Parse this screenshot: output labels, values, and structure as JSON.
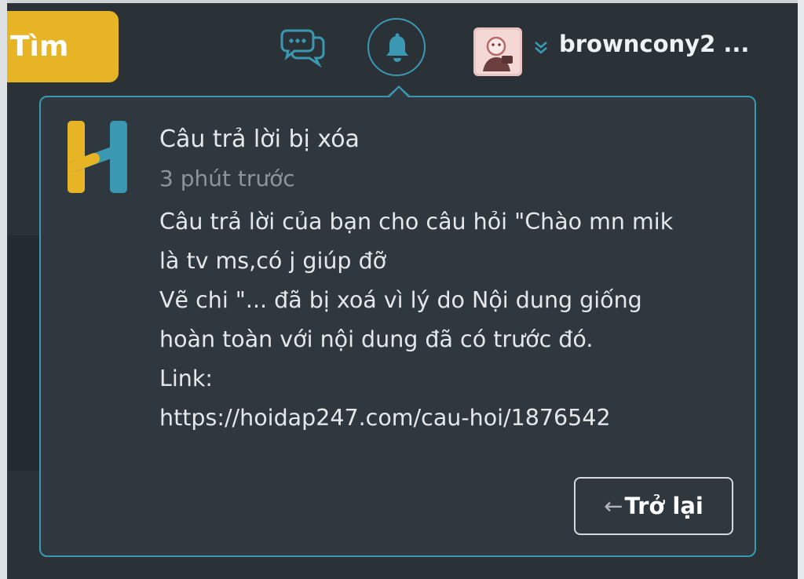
{
  "header": {
    "search_label": "Tìm",
    "username": "browncony2 ..."
  },
  "icons": {
    "messages": "chat-bubbles-icon",
    "notifications": "bell-icon",
    "user_menu": "chevron-double-down-icon"
  },
  "colors": {
    "search_button": "#e7b426",
    "accent": "#3a98b2",
    "panel_bg": "#2f383e",
    "logo_yellow": "#e7b426",
    "logo_blue": "#3a98b2"
  },
  "notification": {
    "title": "Câu trả lời bị xóa",
    "time": "3 phút trước",
    "body_lines": [
      "Câu trả lời của bạn cho câu hỏi \"Chào mn mik",
      "là tv ms,có j giúp đỡ",
      "Vẽ chi \"... đã bị xoá vì lý do Nội dung giống",
      "hoàn toàn với nội dung đã có trước đó.",
      "Link:",
      "https://hoidap247.com/cau-hoi/1876542"
    ]
  },
  "actions": {
    "back_arrow": "←",
    "back_label": "Trở lại"
  }
}
